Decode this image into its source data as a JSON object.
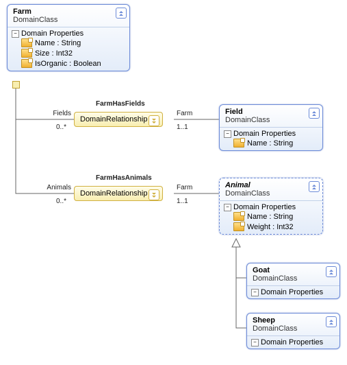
{
  "classes": {
    "farm": {
      "name": "Farm",
      "stereo": "DomainClass",
      "section": "Domain Properties",
      "props": [
        {
          "sig": "Name : String"
        },
        {
          "sig": "Size : Int32"
        },
        {
          "sig": "IsOrganic : Boolean"
        }
      ]
    },
    "field": {
      "name": "Field",
      "stereo": "DomainClass",
      "section": "Domain Properties",
      "props": [
        {
          "sig": "Name : String"
        }
      ]
    },
    "animal": {
      "name": "Animal",
      "stereo": "DomainClass",
      "section": "Domain Properties",
      "props": [
        {
          "sig": "Name : String"
        },
        {
          "sig": "Weight : Int32"
        }
      ]
    },
    "goat": {
      "name": "Goat",
      "stereo": "DomainClass",
      "section": "Domain Properties"
    },
    "sheep": {
      "name": "Sheep",
      "stereo": "DomainClass",
      "section": "Domain Properties"
    }
  },
  "rels": {
    "fhf": {
      "name": "FarmHasFields",
      "type": "DomainRelationship",
      "left": {
        "role": "Fields",
        "mult": "0..*"
      },
      "right": {
        "role": "Farm",
        "mult": "1..1"
      }
    },
    "fha": {
      "name": "FarmHasAnimals",
      "type": "DomainRelationship",
      "left": {
        "role": "Animals",
        "mult": "0..*"
      },
      "right": {
        "role": "Farm",
        "mult": "1..1"
      }
    }
  },
  "chart_data": {
    "type": "diagram",
    "nodes": [
      {
        "id": "Farm",
        "kind": "DomainClass",
        "properties": [
          "Name : String",
          "Size : Int32",
          "IsOrganic : Boolean"
        ]
      },
      {
        "id": "Field",
        "kind": "DomainClass",
        "properties": [
          "Name : String"
        ]
      },
      {
        "id": "Animal",
        "kind": "DomainClass",
        "abstract": true,
        "properties": [
          "Name : String",
          "Weight : Int32"
        ]
      },
      {
        "id": "Goat",
        "kind": "DomainClass",
        "properties": []
      },
      {
        "id": "Sheep",
        "kind": "DomainClass",
        "properties": []
      }
    ],
    "relationships": [
      {
        "name": "FarmHasFields",
        "kind": "DomainRelationship",
        "from": "Farm",
        "to": "Field",
        "fromRole": "Fields",
        "fromMult": "0..*",
        "toRole": "Farm",
        "toMult": "1..1"
      },
      {
        "name": "FarmHasAnimals",
        "kind": "DomainRelationship",
        "from": "Farm",
        "to": "Animal",
        "fromRole": "Animals",
        "fromMult": "0..*",
        "toRole": "Farm",
        "toMult": "1..1"
      }
    ],
    "inheritance": [
      {
        "child": "Goat",
        "parent": "Animal"
      },
      {
        "child": "Sheep",
        "parent": "Animal"
      }
    ]
  }
}
